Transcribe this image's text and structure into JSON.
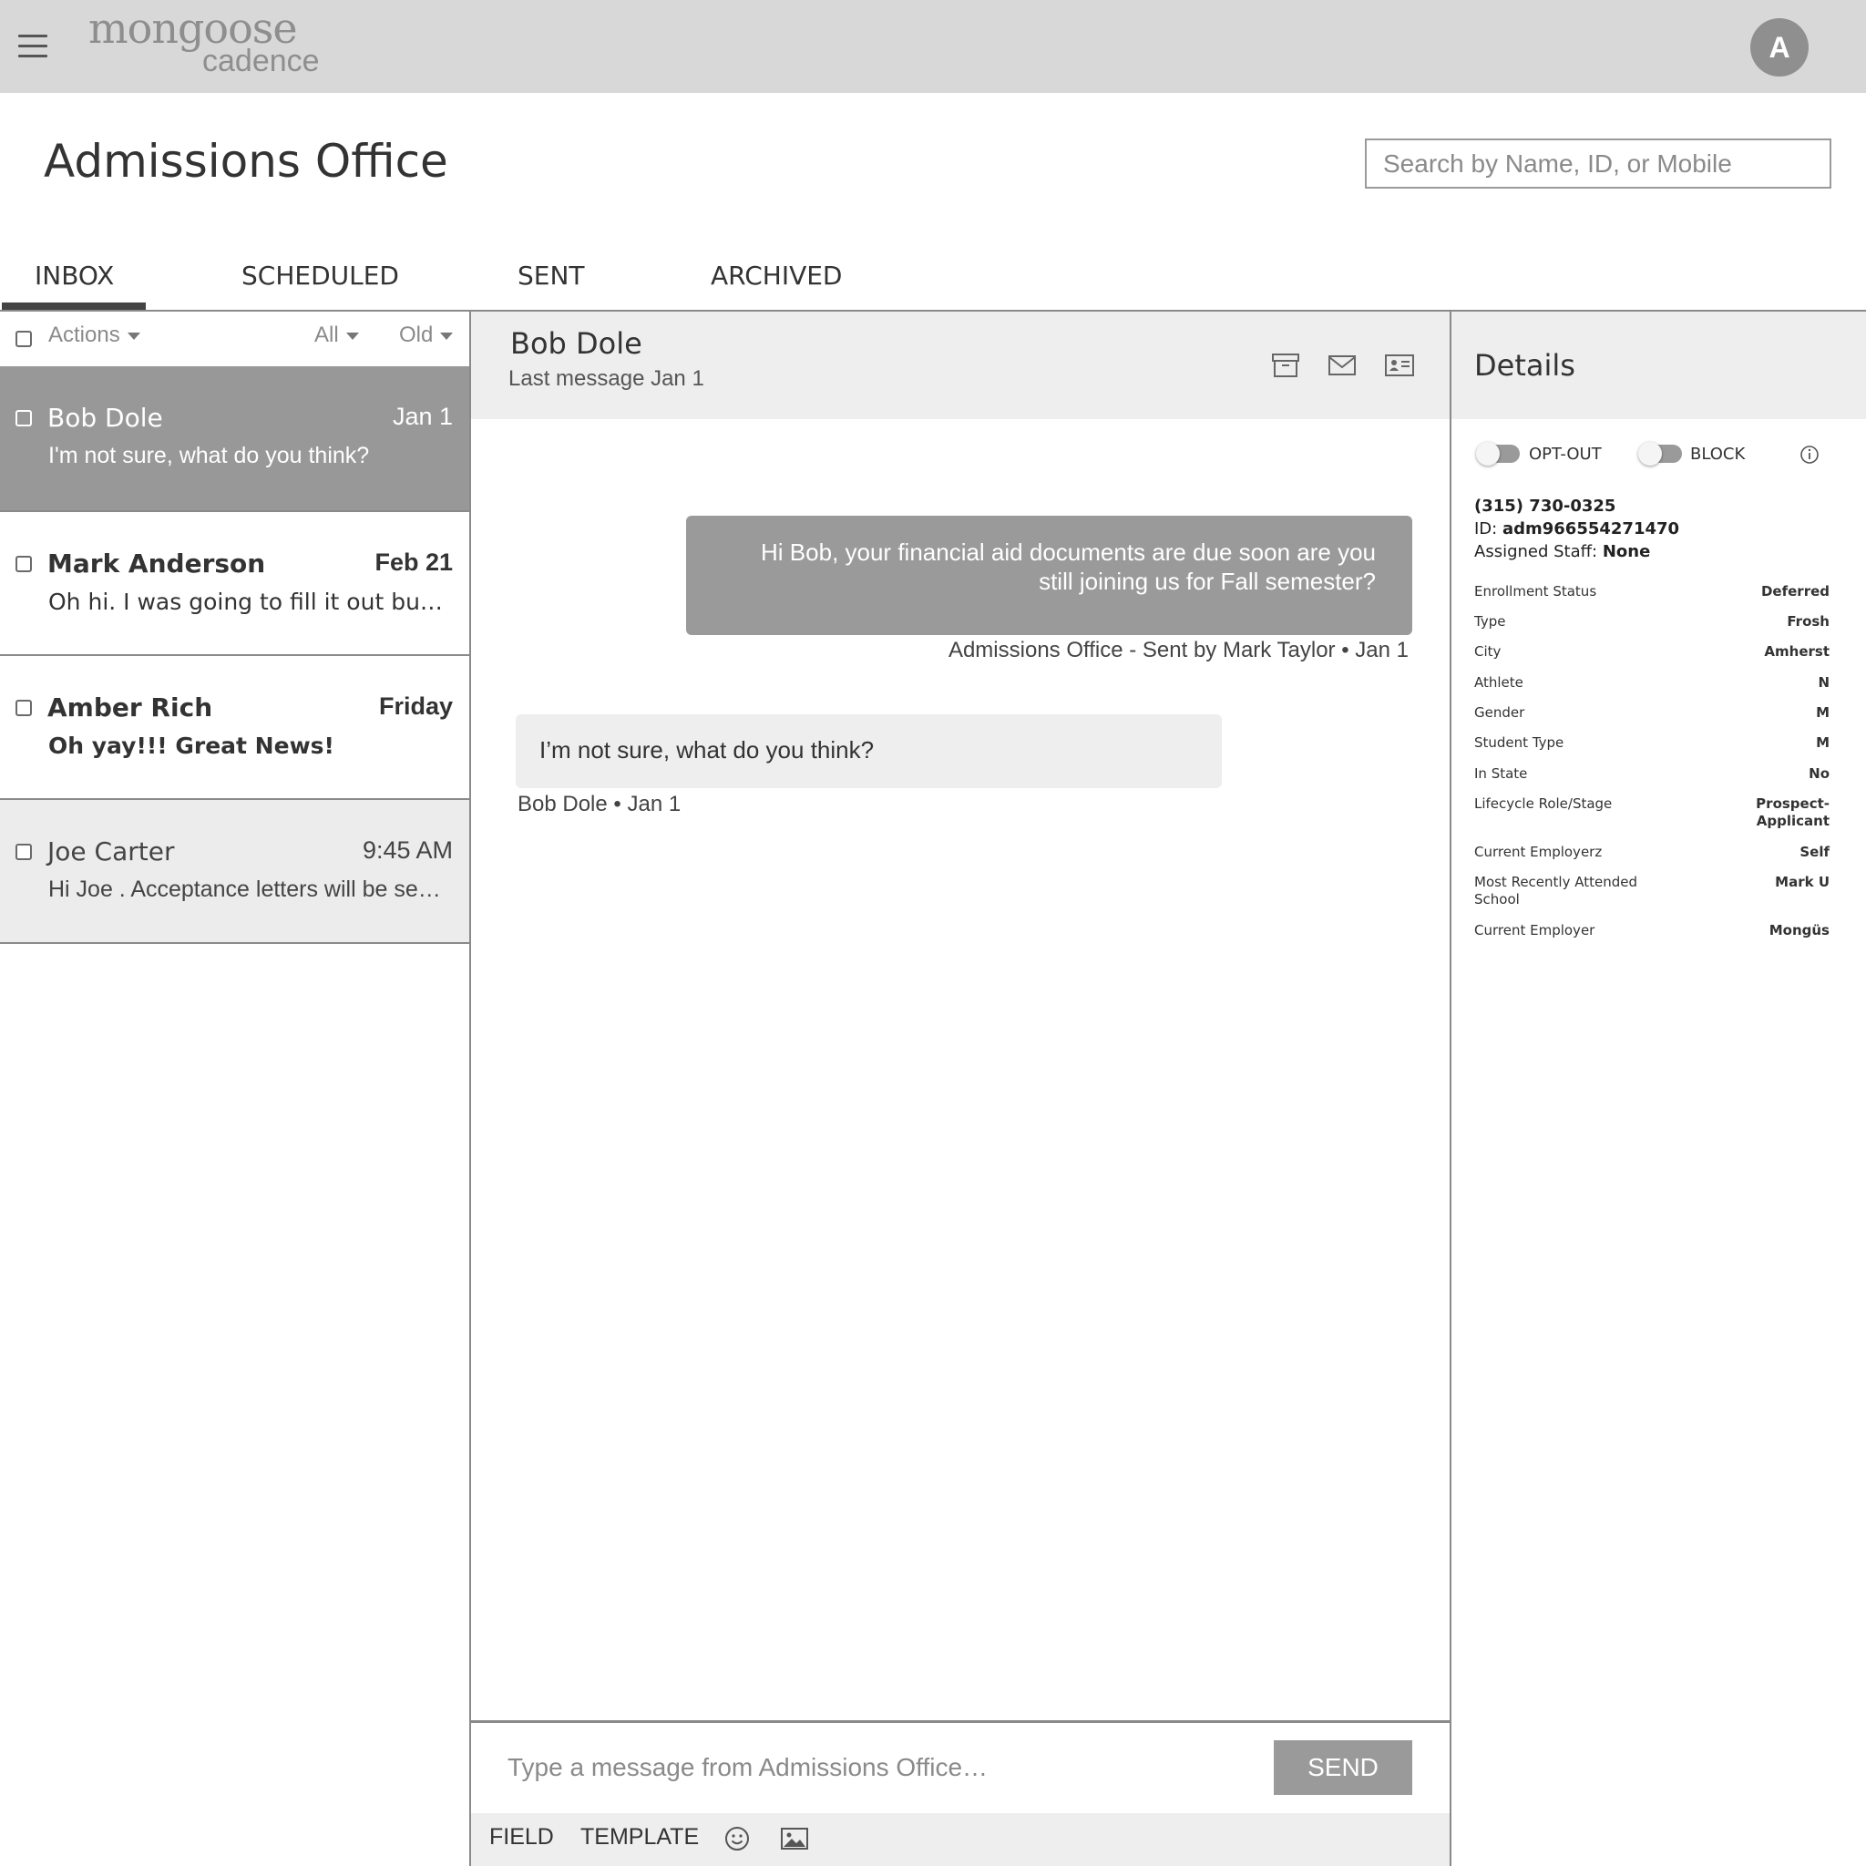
{
  "app": {
    "logo_main": "mongoose",
    "logo_sub": "cadence",
    "avatar_initial": "A"
  },
  "header": {
    "title": "Admissions Office",
    "search_placeholder": "Search by Name, ID, or Mobile"
  },
  "tabs": [
    {
      "label": "INBOX",
      "active": true
    },
    {
      "label": "SCHEDULED",
      "active": false
    },
    {
      "label": "SENT",
      "active": false
    },
    {
      "label": "ARCHIVED",
      "active": false
    }
  ],
  "list_toolbar": {
    "actions_label": "Actions",
    "filter_label": "All",
    "sort_label": "Old"
  },
  "conversations": [
    {
      "name": "Bob Dole",
      "date": "Jan 1",
      "preview": "I'm not sure, what do you think?",
      "selected": true
    },
    {
      "name": "Mark Anderson",
      "date": "Feb 21",
      "preview": "Oh hi. I was going to fill it out but...",
      "unread": true
    },
    {
      "name": "Amber Rich",
      "date": "Friday",
      "preview": "Oh yay!!! Great News!",
      "unread": true
    },
    {
      "name": "Joe Carter",
      "date": "9:45 AM",
      "preview": "Hi Joe . Acceptance letters will be sent out soon"
    }
  ],
  "thread": {
    "contact_name": "Bob Dole",
    "last_message": "Last message Jan 1",
    "messages": [
      {
        "direction": "outgoing",
        "text": "Hi Bob, your financial aid documents are due soon are you still joining us for Fall semester?",
        "meta": "Admissions Office - Sent by Mark Taylor • Jan 1"
      },
      {
        "direction": "incoming",
        "text": "I’m not sure, what do you think?",
        "meta": "Bob Dole • Jan 1"
      }
    ]
  },
  "composer": {
    "placeholder": "Type a message from Admissions Office…",
    "send_label": "SEND",
    "field_label": "FIELD",
    "template_label": "TEMPLATE"
  },
  "details": {
    "title": "Details",
    "optout_label": "OPT-OUT",
    "block_label": "BLOCK",
    "phone": "(315) 730-0325",
    "id_label": "ID:",
    "id_value": "adm966554271470",
    "staff_label": "Assigned Staff:",
    "staff_value": "None",
    "fields": [
      {
        "label": "Enrollment Status",
        "value": "Deferred"
      },
      {
        "label": "Type",
        "value": "Frosh"
      },
      {
        "label": "City",
        "value": "Amherst"
      },
      {
        "label": "Athlete",
        "value": "N"
      },
      {
        "label": "Gender",
        "value": "M"
      },
      {
        "label": "Student Type",
        "value": "M"
      },
      {
        "label": "In State",
        "value": "No"
      },
      {
        "label": "Lifecycle Role/Stage",
        "value": "Prospect-Applicant"
      },
      {
        "label": "Current Employerz",
        "value": "Self"
      },
      {
        "label": "Most Recently Attended School",
        "value": "Mark U"
      },
      {
        "label": "Current Employer",
        "value": "Mongüs"
      }
    ]
  },
  "icons": {
    "menu": "hamburger-menu-icon",
    "archive": "archive-icon",
    "mail": "mail-icon",
    "contact": "contact-card-icon",
    "emoji": "emoji-icon",
    "image": "image-icon",
    "info": "info-icon"
  },
  "colors": {
    "topbar": "#d8d8d8",
    "selected_row": "#989898",
    "outgoing_bubble": "#9a9a9a",
    "incoming_bubble": "#eeeeee",
    "panel_header": "#eeeeee",
    "send_button": "#9a9a9a"
  }
}
